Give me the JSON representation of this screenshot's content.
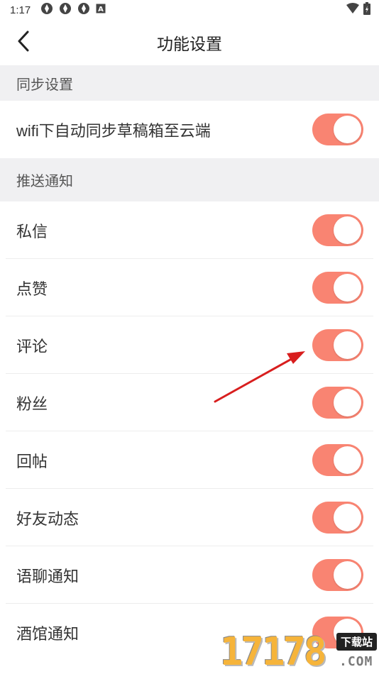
{
  "status_bar": {
    "time": "1:17",
    "notification_icons": [
      "photo-app-icon",
      "photo-app-icon",
      "photo-app-icon",
      "a-box-icon"
    ],
    "right_icons": [
      "wifi-icon",
      "battery-icon"
    ]
  },
  "header": {
    "title": "功能设置",
    "back_icon": "chevron-left-icon"
  },
  "sections": [
    {
      "title": "同步设置",
      "items": [
        {
          "label": "wifi下自动同步草稿箱至云端",
          "enabled": true
        }
      ]
    },
    {
      "title": "推送通知",
      "items": [
        {
          "label": "私信",
          "enabled": true
        },
        {
          "label": "点赞",
          "enabled": true
        },
        {
          "label": "评论",
          "enabled": true
        },
        {
          "label": "粉丝",
          "enabled": true
        },
        {
          "label": "回帖",
          "enabled": true
        },
        {
          "label": "好友动态",
          "enabled": true
        },
        {
          "label": "语聊通知",
          "enabled": true
        },
        {
          "label": "酒馆通知",
          "enabled": true
        }
      ]
    }
  ],
  "annotation": {
    "type": "red-arrow",
    "points_to": "评论 toggle",
    "color": "#e02020"
  },
  "watermark": {
    "digits": "17178",
    "badge": "下载站",
    "suffix": ".COM"
  },
  "colors": {
    "toggle_on": "#f98472",
    "section_bg": "#f0f0f2",
    "arrow": "#e02020"
  }
}
